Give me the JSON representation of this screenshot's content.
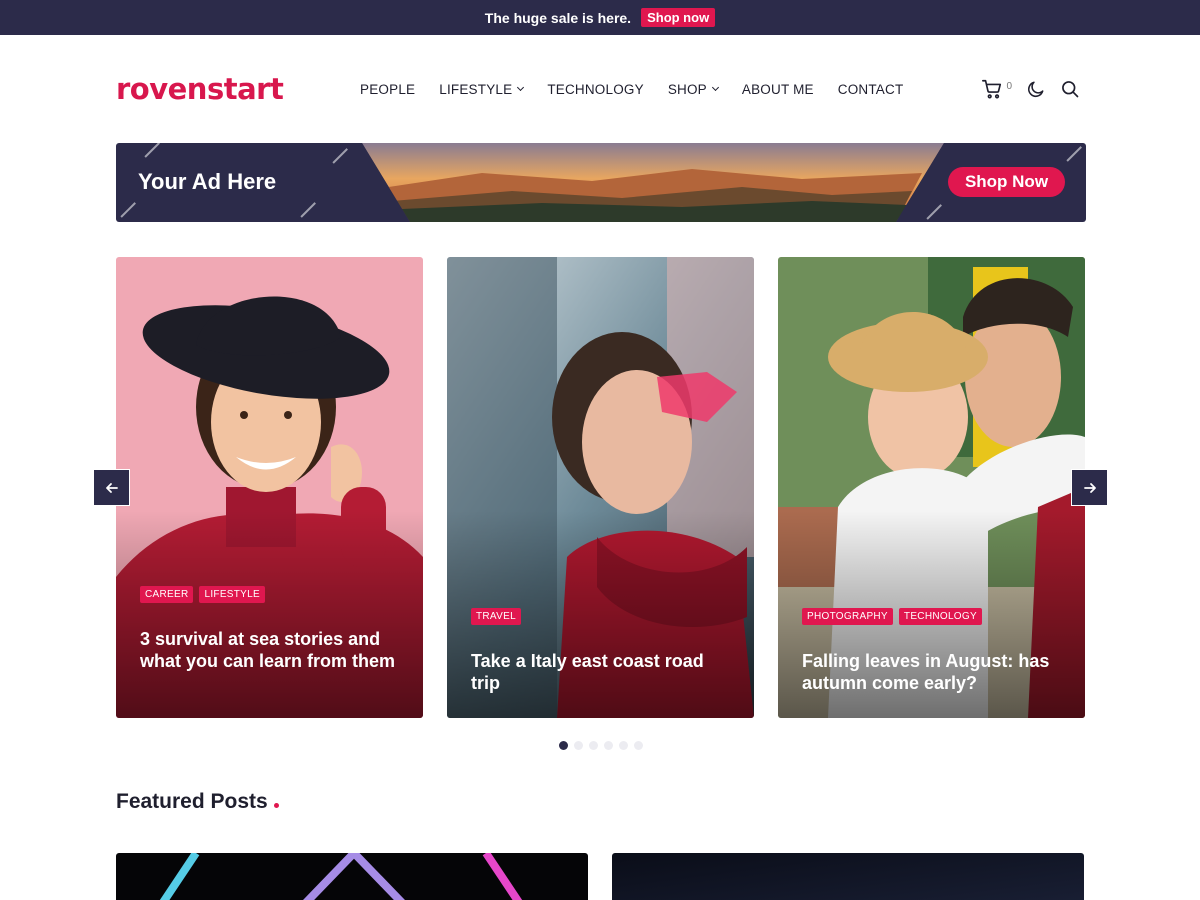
{
  "topbar": {
    "text": "The huge sale is here.",
    "button": "Shop now"
  },
  "header": {
    "logo": "rovenstart",
    "nav": [
      {
        "label": "PEOPLE",
        "dropdown": false
      },
      {
        "label": "LIFESTYLE",
        "dropdown": true
      },
      {
        "label": "TECHNOLOGY",
        "dropdown": false
      },
      {
        "label": "SHOP",
        "dropdown": true
      },
      {
        "label": "ABOUT ME",
        "dropdown": false
      },
      {
        "label": "CONTACT",
        "dropdown": false
      }
    ],
    "cart_count": "0",
    "icons": [
      "cart-icon",
      "moon-icon",
      "search-icon"
    ]
  },
  "ad": {
    "title": "Your Ad Here",
    "button": "Shop Now"
  },
  "slider": {
    "cards": [
      {
        "tags": [
          "CAREER",
          "LIFESTYLE"
        ],
        "title": "3 survival at sea stories and what you can learn from them"
      },
      {
        "tags": [
          "TRAVEL"
        ],
        "title": "Take a Italy east coast road trip"
      },
      {
        "tags": [
          "PHOTOGRAPHY",
          "TECHNOLOGY"
        ],
        "title": "Falling leaves in August: has autumn come early?"
      }
    ],
    "pagination": {
      "total": 6,
      "active": 1
    }
  },
  "featured": {
    "title": "Featured Posts"
  },
  "colors": {
    "accent": "#e0174f",
    "dark": "#2c2b4a"
  }
}
